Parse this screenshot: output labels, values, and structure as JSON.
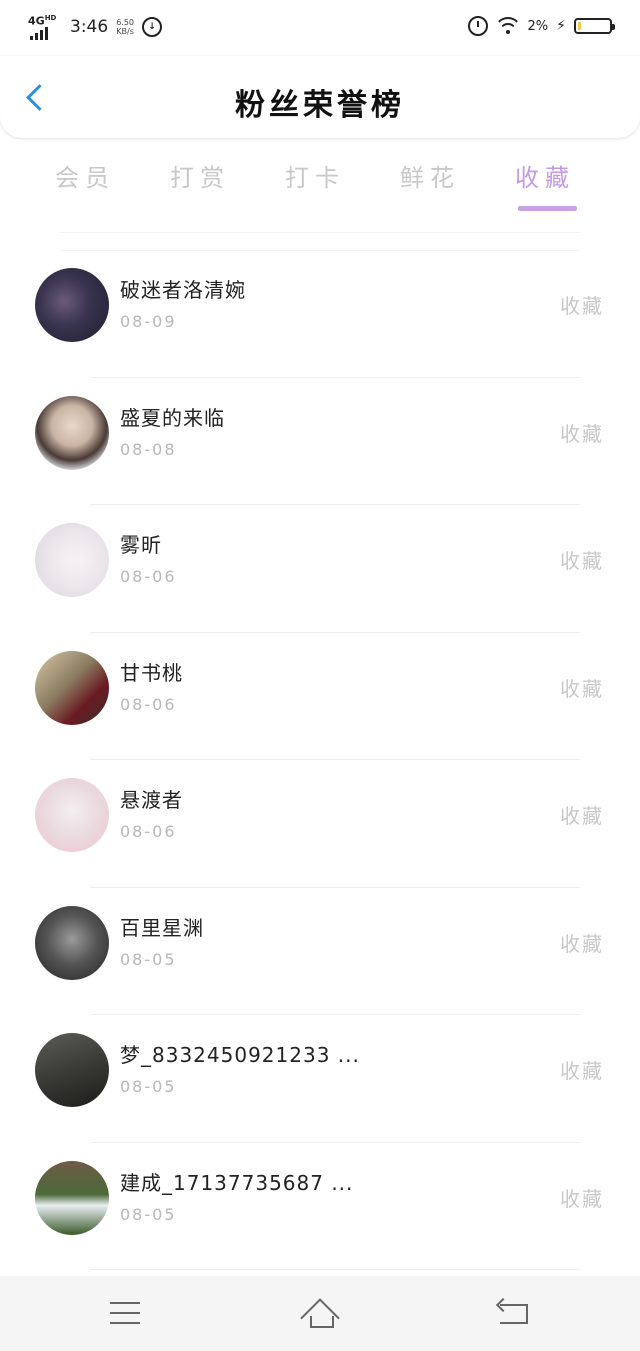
{
  "status_bar": {
    "network": "4G",
    "network_sup": "HD",
    "time": "3:46",
    "speed_value": "6.50",
    "speed_unit": "KB/s",
    "battery": "2%",
    "battery_level": 0.1
  },
  "header": {
    "title": "粉丝荣誉榜"
  },
  "tabs": [
    {
      "label": "会员"
    },
    {
      "label": "打赏"
    },
    {
      "label": "打卡"
    },
    {
      "label": "鲜花"
    },
    {
      "label": "收藏",
      "active": true
    }
  ],
  "fans": [
    {
      "name": "破迷者洛清婉",
      "date": "08-09",
      "action": "收藏"
    },
    {
      "name": "盛夏的来临",
      "date": "08-08",
      "action": "收藏"
    },
    {
      "name": "雾昕",
      "date": "08-06",
      "action": "收藏"
    },
    {
      "name": "甘书桃",
      "date": "08-06",
      "action": "收藏"
    },
    {
      "name": "悬渡者",
      "date": "08-06",
      "action": "收藏"
    },
    {
      "name": "百里星渊",
      "date": "08-05",
      "action": "收藏"
    },
    {
      "name": "梦_8332450921233 ...",
      "date": "08-05",
      "action": "收藏"
    },
    {
      "name": "建成_17137735687 ...",
      "date": "08-05",
      "action": "收藏"
    }
  ],
  "colors": {
    "accent": "#c29be0",
    "back_arrow": "#2a8fe0",
    "inactive_tab": "#c8c8c8"
  },
  "nav": {
    "menu_icon": "menu-icon",
    "home_icon": "home-icon",
    "back_icon": "back-icon"
  }
}
